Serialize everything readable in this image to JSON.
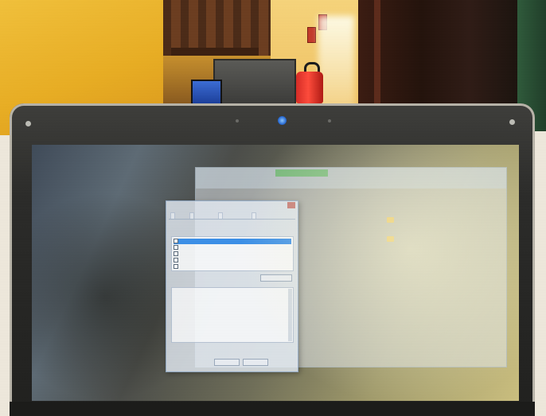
{
  "scene": {
    "description_colors": {
      "wall": "#f2c13a",
      "laptop_bezel": "#2a2a28",
      "webcam_light": "#2a6dd6",
      "extinguisher": "#d62a24",
      "selection_blue": "#3a8fe8"
    },
    "icons": [
      "webcam-icon",
      "fire-extinguisher-icon",
      "folder-icon",
      "close-icon",
      "checkbox-icon"
    ]
  },
  "screen": {
    "explorer": {
      "tabs": [
        "",
        "",
        "",
        ""
      ],
      "folders": [
        "",
        ""
      ]
    },
    "dialog": {
      "title": "",
      "tabs": [
        "",
        "",
        "",
        ""
      ],
      "list_items": [
        "",
        "",
        "",
        "",
        ""
      ],
      "table_rows": [
        "",
        "",
        "",
        "",
        "",
        "",
        "",
        ""
      ],
      "buttons": [
        "",
        "",
        ""
      ]
    }
  }
}
